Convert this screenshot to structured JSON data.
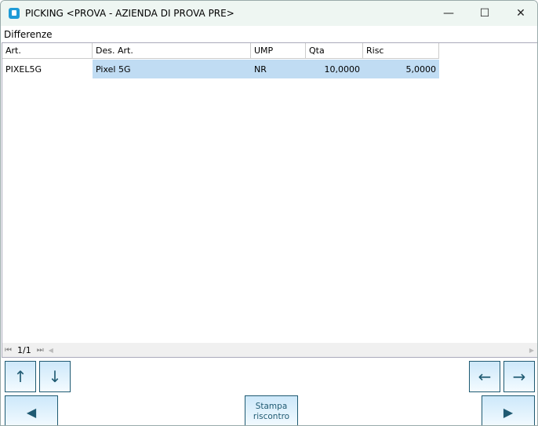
{
  "window": {
    "title": "PICKING <PROVA - AZIENDA DI PROVA PRE>",
    "minimize": "—",
    "maximize": "☐",
    "close": "✕"
  },
  "section_label": "Differenze",
  "table": {
    "columns": [
      "Art.",
      "Des. Art.",
      "UMP",
      "Qta",
      "Risc"
    ],
    "rows": [
      {
        "art": "PIXEL5G",
        "des": "Pixel 5G",
        "ump": "NR",
        "qta": "10,0000",
        "risc": "5,0000"
      }
    ]
  },
  "pager": {
    "first": "⏮",
    "page": "1/1",
    "last": "⏭",
    "scroll_left": "◀",
    "scroll_right": "▶"
  },
  "buttons": {
    "up": "↑",
    "down": "↓",
    "left": "←",
    "right": "→",
    "prev": "◀",
    "next": "▶",
    "print": "Stampa riscontro"
  }
}
